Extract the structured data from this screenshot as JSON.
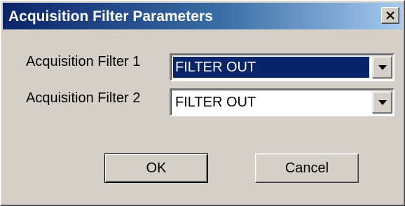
{
  "dialog": {
    "title": "Acquisition Filter Parameters",
    "close_icon": "close-icon"
  },
  "fields": [
    {
      "label": "Acquisition Filter 1",
      "value": "FILTER OUT",
      "selected": true
    },
    {
      "label": "Acquisition Filter 2",
      "value": "FILTER OUT",
      "selected": false
    }
  ],
  "buttons": {
    "ok_label": "OK",
    "cancel_label": "Cancel"
  },
  "colors": {
    "title_gradient_start": "#0a246a",
    "title_gradient_end": "#a6caf0",
    "face": "#d4d0c8",
    "selection": "#0a246a"
  }
}
